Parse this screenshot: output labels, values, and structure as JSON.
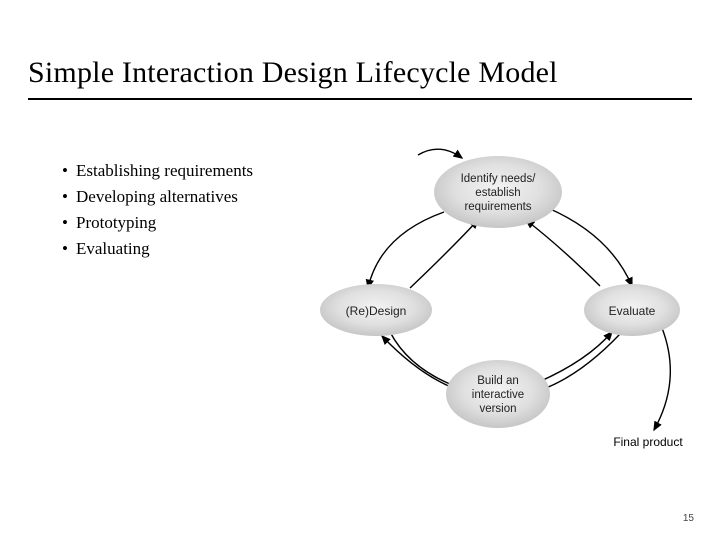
{
  "slide": {
    "title": "Simple Interaction Design Lifecycle Model",
    "page_number": "15"
  },
  "bullets": [
    "Establishing requirements",
    "Developing alternatives",
    "Prototyping",
    "Evaluating"
  ],
  "diagram": {
    "nodes": {
      "identify": {
        "line1": "Identify needs/",
        "line2": "establish",
        "line3": "requirements"
      },
      "redesign": {
        "text": "(Re)Design"
      },
      "build": {
        "line1": "Build an",
        "line2": "interactive",
        "line3": "version"
      },
      "evaluate": {
        "text": "Evaluate"
      }
    },
    "output_label": "Final product"
  }
}
